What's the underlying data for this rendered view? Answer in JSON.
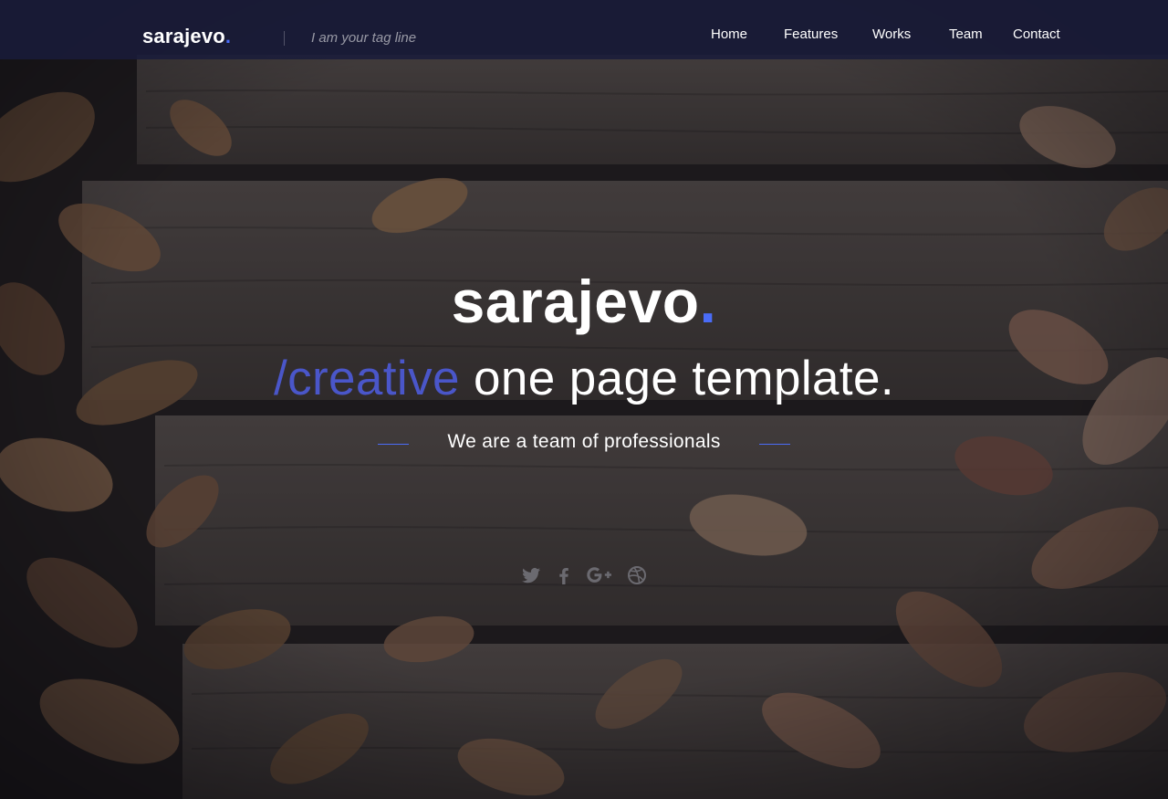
{
  "header": {
    "brand_text": "sarajevo",
    "brand_dot": ".",
    "tagline": "I am your tag line",
    "nav": [
      "Home",
      "Features",
      "Works",
      "Team",
      "Contact"
    ]
  },
  "hero": {
    "title_text": "sarajevo",
    "title_dot": ".",
    "subtitle_accent": "/creative",
    "subtitle_rest": " one page template.",
    "lead": "We are a team of professionals"
  },
  "social": {
    "icons": [
      "twitter-icon",
      "facebook-icon",
      "google-plus-icon",
      "dribbble-icon"
    ]
  },
  "colors": {
    "accent": "#4a6cf7",
    "header_bg": "#1a1c3a"
  }
}
